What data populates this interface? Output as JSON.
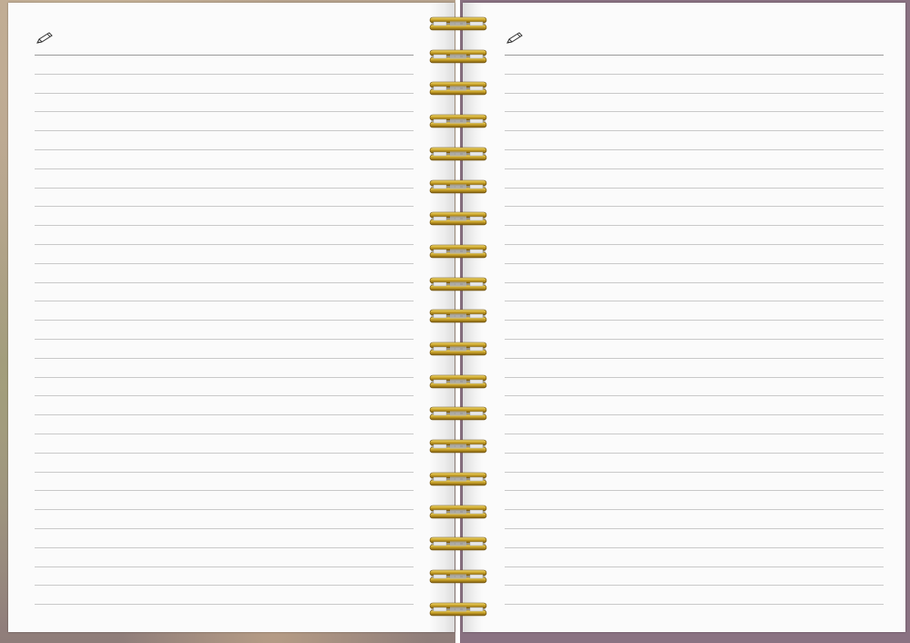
{
  "notebook": {
    "left_page": {
      "ruled_lines": 30,
      "icon": "pencil-icon"
    },
    "right_page": {
      "ruled_lines": 30,
      "icon": "pencil-icon"
    },
    "binding": {
      "rings": 19,
      "ring_color": "#c9a227"
    },
    "colors": {
      "page": "#fbfbfb",
      "rule": "#c9c9c9",
      "cover_right": "#8a7282"
    }
  }
}
